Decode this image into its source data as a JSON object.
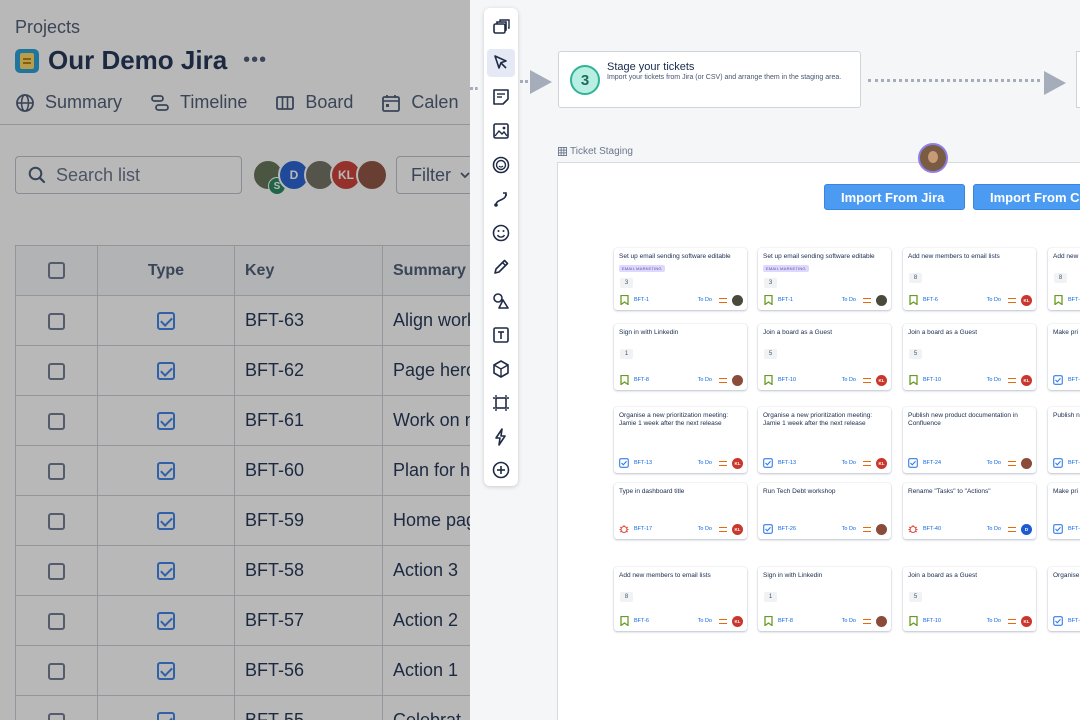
{
  "jira": {
    "breadcrumb": "Projects",
    "project_title": "Our Demo Jira",
    "more": "•••",
    "tabs": [
      {
        "label": "Summary",
        "icon": "globe-icon"
      },
      {
        "label": "Timeline",
        "icon": "timeline-icon"
      },
      {
        "label": "Board",
        "icon": "board-icon"
      },
      {
        "label": "Calen",
        "icon": "calendar-icon"
      }
    ],
    "search_placeholder": "Search list",
    "avatars": [
      {
        "initials": "",
        "color": "#5b6e4f",
        "badge": true
      },
      {
        "initials": "D",
        "color": "#1d5bd1"
      },
      {
        "initials": "",
        "color": "#6a6a5c"
      },
      {
        "initials": "KL",
        "color": "#c9372c"
      },
      {
        "initials": "",
        "color": "#8a4b3a"
      }
    ],
    "filter_label": "Filter",
    "columns": {
      "type": "Type",
      "key": "Key",
      "summary": "Summary"
    },
    "rows": [
      {
        "key": "BFT-63",
        "summary": "Align work"
      },
      {
        "key": "BFT-62",
        "summary": "Page hero"
      },
      {
        "key": "BFT-61",
        "summary": "Work on n"
      },
      {
        "key": "BFT-60",
        "summary": "Plan for h"
      },
      {
        "key": "BFT-59",
        "summary": "Home pag"
      },
      {
        "key": "BFT-58",
        "summary": "Action 3"
      },
      {
        "key": "BFT-57",
        "summary": "Action 2"
      },
      {
        "key": "BFT-56",
        "summary": "Action 1"
      },
      {
        "key": "BFT-55",
        "summary": "Celebrat"
      }
    ]
  },
  "board": {
    "step": {
      "number": "3",
      "title": "Stage your tickets",
      "description": "Import your tickets from Jira (or CSV) and arrange them in the staging area."
    },
    "staging_label": "Ticket Staging",
    "import_jira": "Import From Jira",
    "import_csv": "Import From CSV",
    "tickets": [
      {
        "summary": "Set up email sending software editable",
        "label": "EMAIL MARKETING",
        "estimate": "3",
        "type": "story",
        "key": "BFT-1",
        "status": "To Do",
        "avatar": "",
        "avatar_color": "#4a4a3c"
      },
      {
        "summary": "Set up email sending software editable",
        "label": "EMAIL MARKETING",
        "estimate": "3",
        "type": "story",
        "key": "BFT-1",
        "status": "To Do",
        "avatar": "",
        "avatar_color": "#4a4a3c"
      },
      {
        "summary": "Add new members to email lists",
        "label": "",
        "estimate": "8",
        "type": "story",
        "key": "BFT-6",
        "status": "To Do",
        "avatar": "KL",
        "avatar_color": "#c9372c"
      },
      {
        "summary": "Add new",
        "label": "",
        "estimate": "8",
        "type": "story",
        "key": "BFT-",
        "status": "",
        "avatar": "",
        "avatar_color": ""
      },
      {
        "summary": "Sign in with Linkedin",
        "label": "",
        "estimate": "1",
        "type": "story",
        "key": "BFT-8",
        "status": "To Do",
        "avatar": "",
        "avatar_color": "#8a4b3a"
      },
      {
        "summary": "Join a board as a Guest",
        "label": "",
        "estimate": "5",
        "type": "story",
        "key": "BFT-10",
        "status": "To Do",
        "avatar": "KL",
        "avatar_color": "#c9372c"
      },
      {
        "summary": "Join a board as a Guest",
        "label": "",
        "estimate": "5",
        "type": "story",
        "key": "BFT-10",
        "status": "To Do",
        "avatar": "KL",
        "avatar_color": "#c9372c"
      },
      {
        "summary": "Make pri sure whe change b",
        "label": "",
        "estimate": "",
        "type": "task",
        "key": "BFT-",
        "status": "",
        "avatar": "",
        "avatar_color": ""
      },
      {
        "summary": "Organise a new prioritization meeting: Jamie   1 week after the next release",
        "label": "",
        "estimate": "",
        "type": "task",
        "key": "BFT-13",
        "status": "To Do",
        "avatar": "KL",
        "avatar_color": "#c9372c"
      },
      {
        "summary": "Organise a new prioritization meeting: Jamie   1 week after the next release",
        "label": "",
        "estimate": "",
        "type": "task",
        "key": "BFT-13",
        "status": "To Do",
        "avatar": "KL",
        "avatar_color": "#c9372c"
      },
      {
        "summary": "Publish new product documentation in Confluence",
        "label": "",
        "estimate": "",
        "type": "task",
        "key": "BFT-24",
        "status": "To Do",
        "avatar": "",
        "avatar_color": "#8a4b3a"
      },
      {
        "summary": "Publish n Confluen",
        "label": "",
        "estimate": "",
        "type": "task",
        "key": "BFT-",
        "status": "",
        "avatar": "",
        "avatar_color": ""
      },
      {
        "summary": "Type in dashboard title",
        "label": "",
        "estimate": "",
        "type": "bug",
        "key": "BFT-17",
        "status": "To Do",
        "avatar": "KL",
        "avatar_color": "#c9372c"
      },
      {
        "summary": "Run Tech Debt workshop",
        "label": "",
        "estimate": "",
        "type": "task",
        "key": "BFT-26",
        "status": "To Do",
        "avatar": "",
        "avatar_color": "#8a4b3a"
      },
      {
        "summary": "Rename \"Tasks\" to \"Actions\"",
        "label": "",
        "estimate": "",
        "type": "bug",
        "key": "BFT-40",
        "status": "To Do",
        "avatar": "D",
        "avatar_color": "#1d5bd1"
      },
      {
        "summary": "Make pri sure whe change b",
        "label": "",
        "estimate": "",
        "type": "task",
        "key": "BFT-",
        "status": "",
        "avatar": "",
        "avatar_color": ""
      },
      {
        "summary": "Add new members to email lists",
        "label": "",
        "estimate": "8",
        "type": "story",
        "key": "BFT-6",
        "status": "To Do",
        "avatar": "KL",
        "avatar_color": "#c9372c"
      },
      {
        "summary": "Sign in with Linkedin",
        "label": "",
        "estimate": "1",
        "type": "story",
        "key": "BFT-8",
        "status": "To Do",
        "avatar": "",
        "avatar_color": "#8a4b3a"
      },
      {
        "summary": "Join a board as a Guest",
        "label": "",
        "estimate": "5",
        "type": "story",
        "key": "BFT-10",
        "status": "To Do",
        "avatar": "KL",
        "avatar_color": "#c9372c"
      },
      {
        "summary": "Organise Jamie",
        "label": "",
        "estimate": "",
        "type": "task",
        "key": "BFT-",
        "status": "",
        "avatar": "",
        "avatar_color": ""
      }
    ]
  },
  "toolbar": [
    {
      "icon": "frames-icon"
    },
    {
      "icon": "select-cursor-icon",
      "active": true
    },
    {
      "icon": "sticky-note-icon"
    },
    {
      "icon": "image-icon"
    },
    {
      "icon": "sticker-icon"
    },
    {
      "icon": "connector-icon"
    },
    {
      "icon": "emoji-icon"
    },
    {
      "icon": "pen-icon"
    },
    {
      "icon": "shapes-icon"
    },
    {
      "icon": "text-icon"
    },
    {
      "icon": "3d-box-icon"
    },
    {
      "icon": "frame-icon"
    },
    {
      "icon": "lightning-icon"
    },
    {
      "icon": "add-icon"
    }
  ],
  "colors": {
    "accent": "#4b9bf2",
    "step_badge": "#2fb497",
    "label_bg": "#dfd8fd",
    "link": "#0c66e4",
    "priority": "#e56910"
  }
}
